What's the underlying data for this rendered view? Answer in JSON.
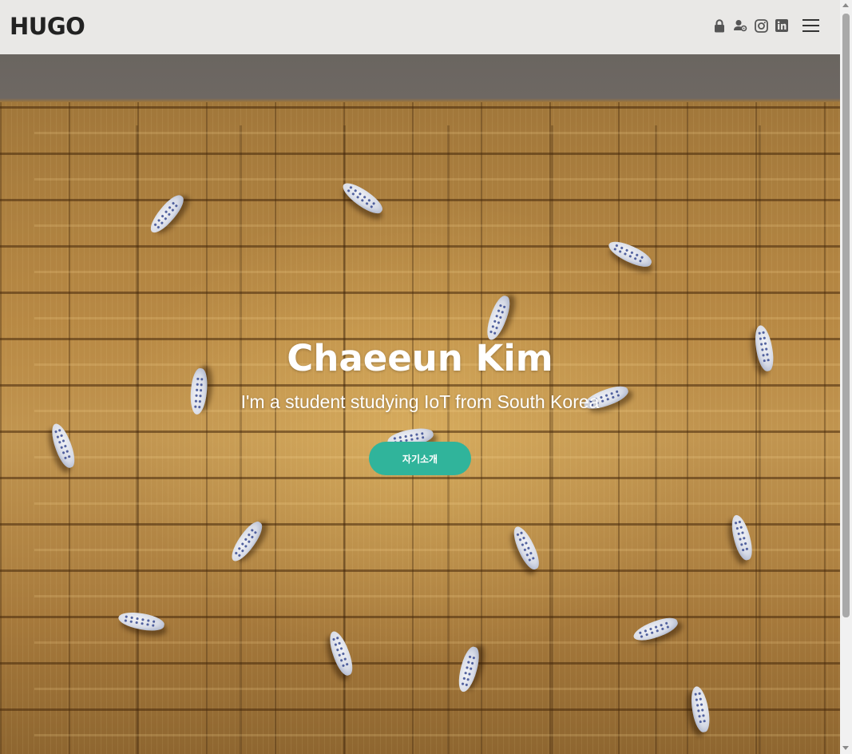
{
  "header": {
    "logo": "HUGO",
    "icons": [
      "lock-icon",
      "user-settings-icon",
      "instagram-icon",
      "linkedin-icon"
    ],
    "menu_icon": "hamburger-menu-icon"
  },
  "hero": {
    "title": "Chaeeun Kim",
    "subtitle": "I'm a student studying IoT from South Korea",
    "button_label": "자기소개",
    "background_image": "wooden wall with ceramic fish sculptures"
  },
  "colors": {
    "header_bg": "#e9e8e6",
    "logo": "#222222",
    "icon": "#555555",
    "button_bg": "#30b49b",
    "button_text": "#ffffff",
    "hero_text": "#ffffff"
  }
}
